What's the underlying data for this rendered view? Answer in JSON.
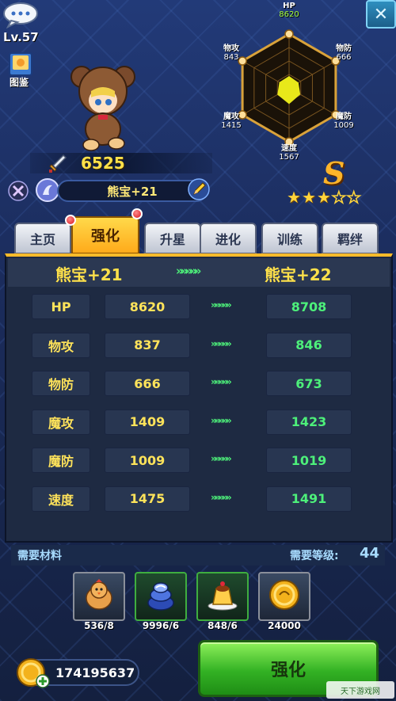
{
  "player": {
    "level": "Lv.57"
  },
  "menu": {
    "book_label": "图鉴"
  },
  "hero": {
    "power": "6525",
    "name": "熊宝+21",
    "grade": "S",
    "stars": {
      "filled": 3,
      "total": 5
    }
  },
  "radar": {
    "stats": [
      {
        "label": "HP",
        "value": "8620",
        "highlight": true
      },
      {
        "label": "物防",
        "value": "666"
      },
      {
        "label": "魔防",
        "value": "1009"
      },
      {
        "label": "速度",
        "value": "1567"
      },
      {
        "label": "魔攻",
        "value": "1415"
      },
      {
        "label": "物攻",
        "value": "843"
      }
    ],
    "fill_color": "#e8e81a"
  },
  "tabs": [
    {
      "label": "主页",
      "badge": false
    },
    {
      "label": "强化",
      "badge": true,
      "active": true
    },
    {
      "label": "升星",
      "badge": false
    },
    {
      "label": "进化",
      "badge": false
    },
    {
      "label": "训练",
      "badge": false
    },
    {
      "label": "羁绊",
      "badge": false
    }
  ],
  "upgrade": {
    "from": "熊宝+21",
    "arrows": "»»»»»",
    "to": "熊宝+22",
    "rows": [
      {
        "name": "HP",
        "old": "8620",
        "arrow": "»»»»»",
        "new": "8708"
      },
      {
        "name": "物攻",
        "old": "837",
        "arrow": "»»»»»",
        "new": "846"
      },
      {
        "name": "物防",
        "old": "666",
        "arrow": "»»»»»",
        "new": "673"
      },
      {
        "name": "魔攻",
        "old": "1409",
        "arrow": "»»»»»",
        "new": "1423"
      },
      {
        "name": "魔防",
        "old": "1009",
        "arrow": "»»»»»",
        "new": "1019"
      },
      {
        "name": "速度",
        "old": "1475",
        "arrow": "»»»»»",
        "new": "1491"
      }
    ]
  },
  "materials": {
    "label": "需要材料",
    "req_label": "需要等级:",
    "req_level": "44",
    "items": [
      {
        "icon": "chick-icon",
        "count": "536/8",
        "frame": "gray"
      },
      {
        "icon": "blue-vortex-icon",
        "count": "9996/6",
        "frame": "green"
      },
      {
        "icon": "pudding-icon",
        "count": "848/6",
        "frame": "green"
      },
      {
        "icon": "gold-coin-icon",
        "count": "24000",
        "frame": "gray"
      }
    ]
  },
  "gold": {
    "amount": "174195637"
  },
  "actions": {
    "enhance": "强化"
  },
  "watermark": {
    "text": "天下游戏网"
  },
  "colors": {
    "accent": "#ffbb2a",
    "gain": "#4df07a",
    "value": "#ffe35a"
  }
}
